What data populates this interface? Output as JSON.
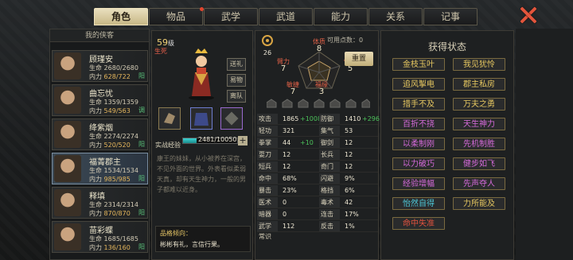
{
  "tabs": [
    {
      "label": "角色",
      "active": true
    },
    {
      "label": "物品",
      "badge": true
    },
    {
      "label": "武学"
    },
    {
      "label": "武道"
    },
    {
      "label": "能力"
    },
    {
      "label": "关系"
    },
    {
      "label": "记事"
    }
  ],
  "list_title": "我的侠客",
  "heroes": [
    {
      "name": "顾瑾安",
      "hp": "2680/2680",
      "mp": "628/722",
      "align": "阳",
      "hp_label": "生命",
      "mp_label": "内力"
    },
    {
      "name": "曲忘忧",
      "hp": "1359/1359",
      "mp": "549/563",
      "align": "调",
      "hp_label": "生命",
      "mp_label": "内力"
    },
    {
      "name": "绛紫烟",
      "hp": "2274/2274",
      "mp": "520/520",
      "align": "阳",
      "hp_label": "生命",
      "mp_label": "内力"
    },
    {
      "name": "福菁郡主",
      "hp": "1534/1534",
      "mp": "985/985",
      "align": "阳",
      "hp_label": "生命",
      "mp_label": "内力",
      "selected": true
    },
    {
      "name": "释填",
      "hp": "2314/2314",
      "mp": "870/870",
      "align": "阳",
      "hp_label": "生命",
      "mp_label": "内力"
    },
    {
      "name": "苗彩蝶",
      "hp": "1685/1685",
      "mp": "136/160",
      "align": "阳",
      "hp_label": "生命",
      "mp_label": "内力"
    }
  ],
  "hero_card": {
    "level": "59",
    "level_unit": "级",
    "nickname": "生死",
    "btn_gift": "送礼",
    "btn_outfit": "易物",
    "btn_leave": "离队",
    "xp_label": "实战经验",
    "xp_text": "2481/10050",
    "xp_ratio": 0.247,
    "plus": "+",
    "bio": "康王的妹妹，从小被养在深宫，不见外面的世界。外表看似柔弱天真，却有天生神力，一般的男子都难以近身。",
    "trait_head": "品格倾向：",
    "trait_text": "彬彬有礼，言信行果。"
  },
  "stats": {
    "potential": "26",
    "points_label": "可用点数：",
    "points": "0",
    "reset": "重置",
    "attrs": [
      {
        "label": "体质",
        "value": "8"
      },
      {
        "label": "臂力",
        "value": "7"
      },
      {
        "label": "悟性",
        "value": "5"
      },
      {
        "label": "敏捷",
        "value": "7"
      },
      {
        "label": "福缘",
        "value": "3"
      }
    ],
    "rows": [
      [
        "攻击力",
        "1865",
        "+1008",
        "防御力",
        "1410",
        "+296"
      ],
      [
        "轻功",
        "321",
        "",
        "集气速度",
        "53",
        ""
      ],
      [
        "拳掌",
        "44",
        "+10",
        "御剑",
        "12",
        ""
      ],
      [
        "耍刀",
        "12",
        "",
        "长兵",
        "12",
        ""
      ],
      [
        "短兵",
        "12",
        "",
        "奇门",
        "12",
        ""
      ],
      [
        "命中",
        "68%",
        "",
        "闪避",
        "9%",
        ""
      ],
      [
        "暴击",
        "23%",
        "",
        "格挡",
        "6%",
        ""
      ],
      [
        "医术",
        "0",
        "",
        "毒术",
        "42",
        ""
      ],
      [
        "暗器",
        "0",
        "",
        "连击",
        "17%",
        ""
      ],
      [
        "武学常识",
        "112",
        "",
        "反击",
        "1%",
        ""
      ]
    ]
  },
  "states": {
    "title": "获得状态",
    "items": [
      {
        "label": "金枝玉叶",
        "color": "gold"
      },
      {
        "label": "我见犹怜",
        "color": "gold"
      },
      {
        "label": "追风掣电",
        "color": "gold"
      },
      {
        "label": "郡主私房",
        "color": "gold"
      },
      {
        "label": "措手不及",
        "color": "gold"
      },
      {
        "label": "万夫之勇",
        "color": "gold"
      },
      {
        "label": "百折不挠",
        "color": "mag"
      },
      {
        "label": "天生神力",
        "color": "mag"
      },
      {
        "label": "以柔制刚",
        "color": "mag"
      },
      {
        "label": "先机制胜",
        "color": "mag"
      },
      {
        "label": "以力破巧",
        "color": "mag"
      },
      {
        "label": "健步如飞",
        "color": "mag"
      },
      {
        "label": "经验增幅",
        "color": "mag"
      },
      {
        "label": "先声夺人",
        "color": "mag"
      },
      {
        "label": "怡然自得",
        "color": "cyan"
      },
      {
        "label": "力所能及",
        "color": "gold"
      },
      {
        "label": "命中失准",
        "color": "red"
      }
    ]
  }
}
